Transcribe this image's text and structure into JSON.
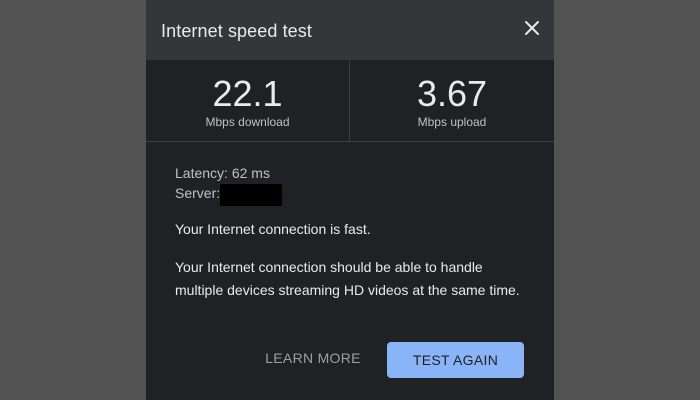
{
  "dialog": {
    "title": "Internet speed test",
    "close_icon": "close-icon"
  },
  "results": {
    "download": {
      "value": "22.1",
      "unit": "Mbps download"
    },
    "upload": {
      "value": "3.67",
      "unit": "Mbps upload"
    }
  },
  "info": {
    "latency_label": "Latency:",
    "latency_value": "62 ms",
    "server_label": "Server:"
  },
  "messages": {
    "fast": "Your Internet connection is fast.",
    "capable": "Your Internet connection should be able to handle multiple devices streaming HD videos at the same time."
  },
  "actions": {
    "learn_more": "LEARN MORE",
    "test_again": "TEST AGAIN"
  },
  "colors": {
    "backdrop": "#535353",
    "dialog_bg": "#202124",
    "header_bg": "#35363a",
    "accent": "#8ab4f8"
  }
}
